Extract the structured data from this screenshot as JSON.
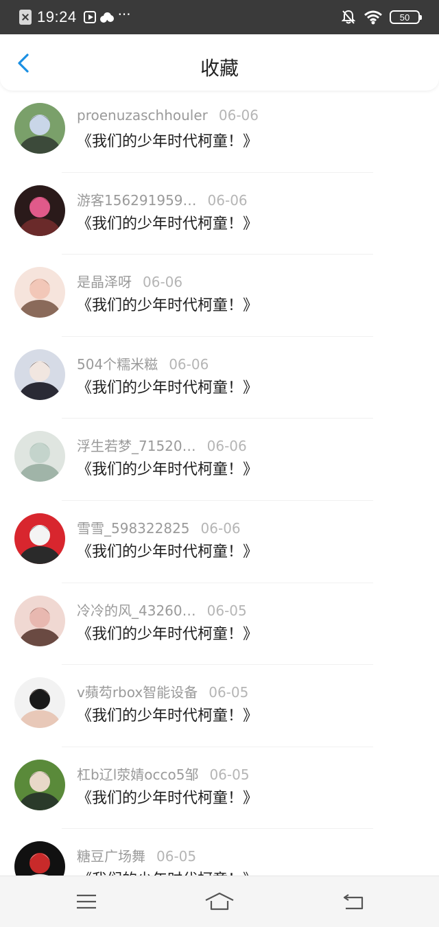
{
  "status_bar": {
    "time": "19:24",
    "more": "···",
    "battery": "50"
  },
  "header": {
    "title": "收藏"
  },
  "favorites": [
    {
      "username": "proenuzaschhouler",
      "date": "06-06",
      "title": "《我们的少年时代柯童！》",
      "avatar_colors": [
        "#7aa06a",
        "#c9d6e8",
        "#3c4a3a"
      ]
    },
    {
      "username": "游客156291959…",
      "date": "06-06",
      "title": "《我们的少年时代柯童！》",
      "avatar_colors": [
        "#2a1a1a",
        "#e05a8a",
        "#6a2a2a"
      ]
    },
    {
      "username": "是晶泽呀",
      "date": "06-06",
      "title": "《我们的少年时代柯童！》",
      "avatar_colors": [
        "#f6e4dc",
        "#f2c7b8",
        "#8a6a5a"
      ]
    },
    {
      "username": "504个糯米糍",
      "date": "06-06",
      "title": "《我们的少年时代柯童！》",
      "avatar_colors": [
        "#d6dbe6",
        "#f1e6e0",
        "#2a2a35"
      ]
    },
    {
      "username": "浮生若梦_71520…",
      "date": "06-06",
      "title": "《我们的少年时代柯童！》",
      "avatar_colors": [
        "#dfe5e0",
        "#c4d4cc",
        "#a0b4a8"
      ]
    },
    {
      "username": "雪雪_598322825",
      "date": "06-06",
      "title": "《我们的少年时代柯童！》",
      "avatar_colors": [
        "#d8262e",
        "#f4f4f4",
        "#2a2a2a"
      ]
    },
    {
      "username": "冷冷的风_43260…",
      "date": "06-05",
      "title": "《我们的少年时代柯童！》",
      "avatar_colors": [
        "#f0d8d2",
        "#e8b8b0",
        "#6a4a42"
      ]
    },
    {
      "username": "v蘋芶rbox智能设备",
      "date": "06-05",
      "title": "《我们的少年时代柯童！》",
      "avatar_colors": [
        "#f2f2f2",
        "#1a1a1a",
        "#e8c8b8"
      ]
    },
    {
      "username": "杠b辽l荥婧occo5邹",
      "date": "06-05",
      "title": "《我们的少年时代柯童！》",
      "avatar_colors": [
        "#5a8a3a",
        "#e8d8c8",
        "#2a3a2a"
      ]
    },
    {
      "username": "糖豆广场舞",
      "date": "06-05",
      "title": "《我们的少年时代柯童！》",
      "avatar_colors": [
        "#111111",
        "#c82a2a",
        "#f0f0f0"
      ]
    }
  ],
  "colors": {
    "accent": "#1a8fe3",
    "status_bar_bg": "#3a3a3a",
    "username": "#9a9a9a",
    "title_text": "#1e1e1e"
  },
  "bottom_nav": {
    "items": [
      "menu-icon",
      "home-icon",
      "back-icon"
    ]
  }
}
